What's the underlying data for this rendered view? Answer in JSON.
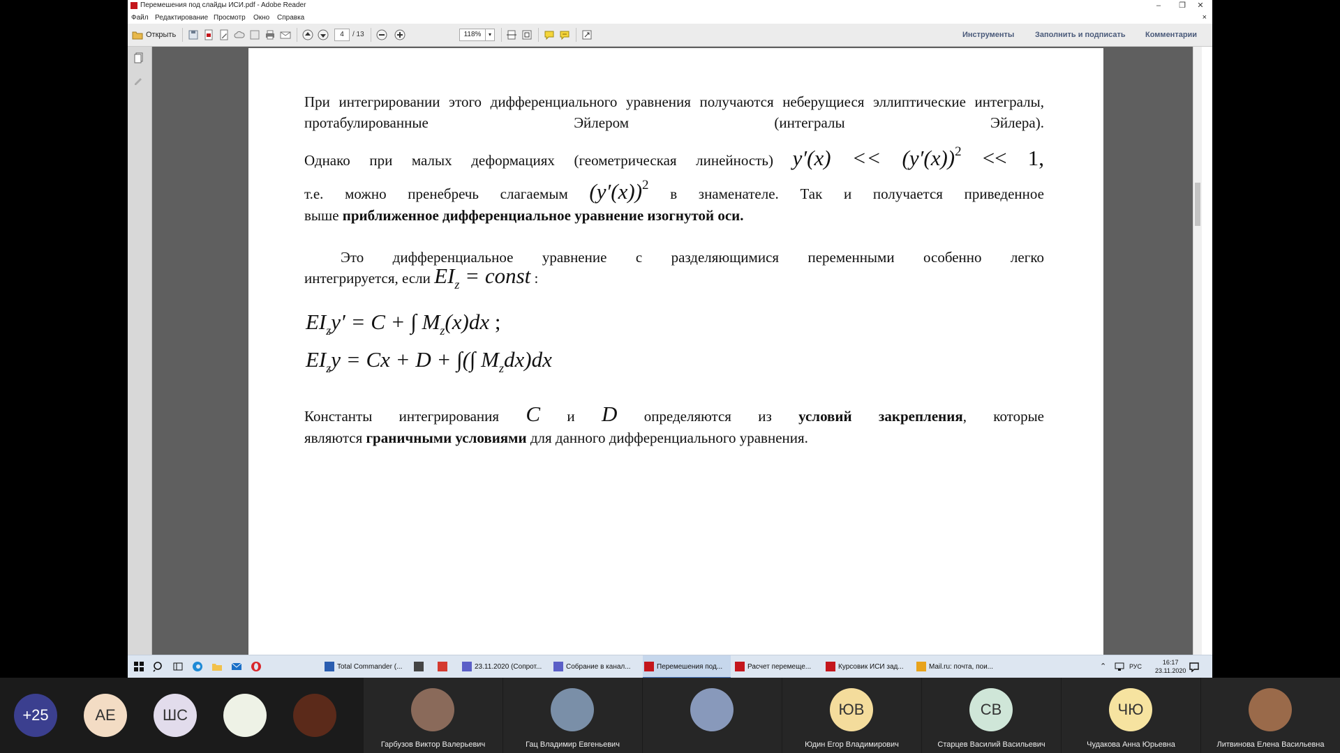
{
  "window": {
    "title": "Перемешения под слайды ИСИ.pdf - Adobe Reader",
    "minimize": "–",
    "maximize": "❐",
    "close": "✕"
  },
  "menu": {
    "items": [
      "Файл",
      "Редактирование",
      "Просмотр",
      "Окно",
      "Справка"
    ],
    "close_doc": "×"
  },
  "toolbar": {
    "open_label": "Открыть",
    "page_current": "4",
    "page_total": "/ 13",
    "zoom": "118%",
    "tools_label": "Инструменты",
    "fill_sign_label": "Заполнить и подписать",
    "comments_label": "Комментарии"
  },
  "document": {
    "p1": "При интегрировании этого дифференциального уравнения получаются неберущиеся эллиптические интегралы, протабулированные Эйлером (интегралы Эйлера).",
    "p2_start": "Однако при малых деформациях (геометрическая линейность)",
    "p2_formula": "y′(x) << (y′(x))",
    "p2_exp": "2",
    "p2_end": " << 1,",
    "p3_start": "т.е. можно пренебречь слагаемым",
    "p3_formula": "(y′(x))",
    "p3_exp": "2",
    "p3_end": "в знаменателе. Так и получается приведенное",
    "p4_start": "выше ",
    "p4_bold": "приближенное дифференциальное уравнение изогнутой оси.",
    "p5": "Это дифференциальное уравнение с разделяющимися переменными особенно легко",
    "p6_start": "интегрируется, если",
    "p6_ei": "EI",
    "p6_sub": "z",
    "p6_rest": " = const",
    "p6_colon": " :",
    "eq1_a": "EI",
    "eq1_sub": "z",
    "eq1_b": "y′ = C + ∫ M",
    "eq1_sub2": "z",
    "eq1_c": "(x)dx",
    "eq1_semi": " ;",
    "eq2_a": "EI",
    "eq2_sub": "z",
    "eq2_b": "y = Cx + D + ∫(∫ M",
    "eq2_sub2": "z",
    "eq2_c": "dx)dx",
    "p7_start": "Константы интегрирования",
    "p7_c": "C",
    "p7_and": "и",
    "p7_d": "D",
    "p7_mid": "определяются из",
    "p7_bold": "условий закрепления",
    "p7_end": ", которые",
    "p8_start": "являются ",
    "p8_bold": "граничными условиями",
    "p8_end": " для данного дифференциального уравнения."
  },
  "taskbar": {
    "apps": [
      {
        "label": "Total Commander (...",
        "color": "#2a5db0"
      },
      {
        "label": "",
        "color": "#444444"
      },
      {
        "label": "",
        "color": "#d43a2f"
      },
      {
        "label": "23.11.2020 (Сопрот...",
        "color": "#5b5fc7"
      },
      {
        "label": "Собрание в канал...",
        "color": "#5b5fc7"
      },
      {
        "label": "Перемешения под...",
        "color": "#c4161c"
      },
      {
        "label": "Расчет перемеще...",
        "color": "#c4161c"
      },
      {
        "label": "Курсовик ИСИ зад...",
        "color": "#c4161c"
      },
      {
        "label": "Mail.ru: почта, пои...",
        "color": "#e8a31c"
      }
    ],
    "lang": "РУС",
    "time": "16:17",
    "date": "23.11.2020"
  },
  "participants": [
    {
      "initials": "+25",
      "name": "",
      "bg": "#3b3f8f",
      "fg": "#ffffff"
    },
    {
      "initials": "АЕ",
      "name": "",
      "bg": "#f3dcc4",
      "fg": "#333333"
    },
    {
      "initials": "ШС",
      "name": "",
      "bg": "#e2dcec",
      "fg": "#333333"
    },
    {
      "initials": "",
      "name": "",
      "bg": "#eef2e6",
      "fg": "#333333"
    },
    {
      "initials": "",
      "name": "",
      "bg": "#5b2a1a",
      "fg": "#333333"
    },
    {
      "initials": "",
      "name": "Гарбузов Виктор Валерьевич",
      "bg": "#8a6a5a",
      "fg": "#333333"
    },
    {
      "initials": "",
      "name": "Гац Владимир Евгеньевич",
      "bg": "#7a8fa8",
      "fg": "#333333"
    },
    {
      "initials": "",
      "name": "",
      "bg": "#8899bb",
      "fg": "#333333"
    },
    {
      "initials": "ЮВ",
      "name": "Юдин Егор Владимирович",
      "bg": "#f4dc9c",
      "fg": "#333333"
    },
    {
      "initials": "СВ",
      "name": "Старцев Василий Васильевич",
      "bg": "#cfe6d8",
      "fg": "#333333"
    },
    {
      "initials": "ЧЮ",
      "name": "Чудакова Анна Юрьевна",
      "bg": "#f6e3a0",
      "fg": "#333333"
    },
    {
      "initials": "",
      "name": "Литвинова Елена Васильевна",
      "bg": "#9a6a4a",
      "fg": "#333333"
    }
  ]
}
